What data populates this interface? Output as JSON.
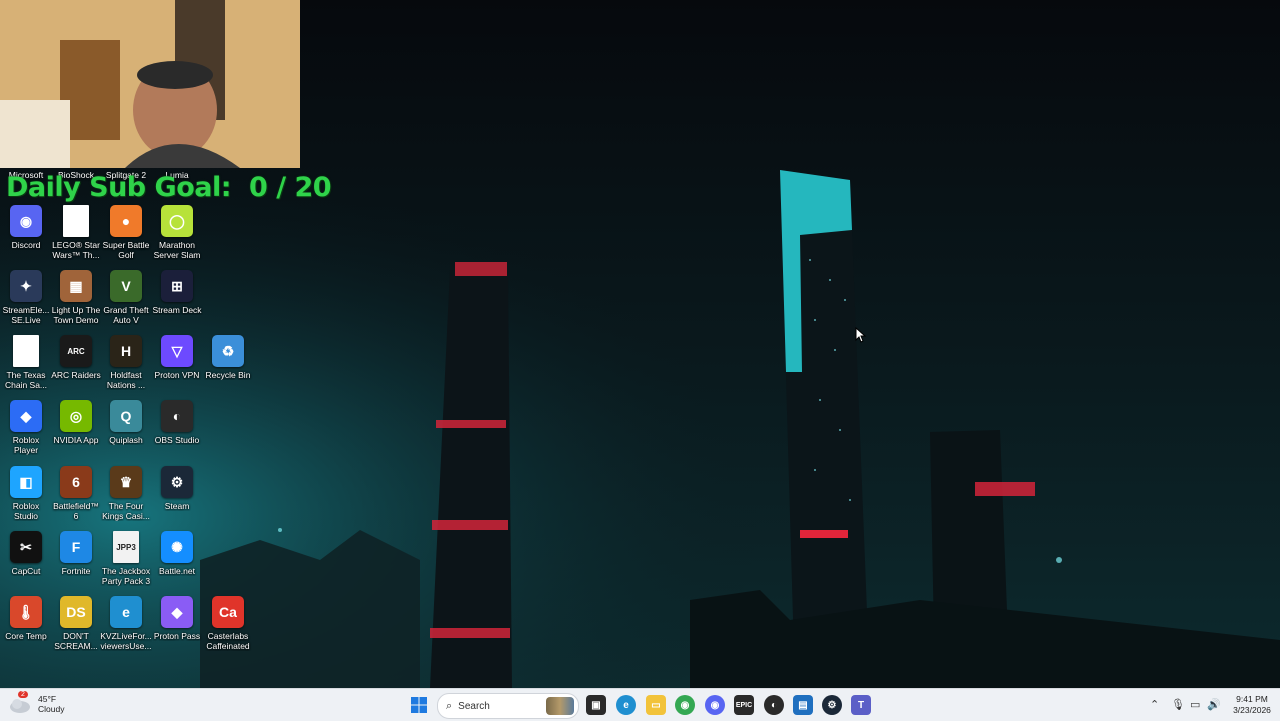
{
  "overlay": {
    "goal_label": "Daily Sub Goal:",
    "goal_value": "0 / 20"
  },
  "desktop": {
    "top_row": [
      "Microsoft",
      "BioShock",
      "Splitgate 2",
      "Lumia"
    ],
    "icons": [
      {
        "label": "Discord",
        "icon": "discord-icon",
        "color": "#5865f2",
        "glyph": "◉"
      },
      {
        "label": "LEGO® Star Wars™ Th...",
        "icon": "file-icon",
        "color": "#ffffff",
        "glyph": ""
      },
      {
        "label": "Super Battle Golf",
        "icon": "golf-icon",
        "color": "#f07a2a",
        "glyph": "●"
      },
      {
        "label": "Marathon Server Slam",
        "icon": "marathon-icon",
        "color": "#b7e23a",
        "glyph": "◯"
      },
      {
        "label": "StreamEle... SE.Live",
        "icon": "streamelements-icon",
        "color": "#2a3a5a",
        "glyph": "✦"
      },
      {
        "label": "Light Up The Town Demo",
        "icon": "game-icon",
        "color": "#a0643a",
        "glyph": "▦"
      },
      {
        "label": "Grand Theft Auto V",
        "icon": "gta-icon",
        "color": "#3a6a2a",
        "glyph": "V"
      },
      {
        "label": "Stream Deck",
        "icon": "stream-deck-icon",
        "color": "#1b1f3a",
        "glyph": "⊞"
      },
      {
        "label": "The Texas Chain Sa...",
        "icon": "file-icon",
        "color": "#ffffff",
        "glyph": ""
      },
      {
        "label": "ARC Raiders",
        "icon": "arc-raiders-icon",
        "color": "#1a1a1a",
        "glyph": "ARC"
      },
      {
        "label": "Holdfast Nations ...",
        "icon": "holdfast-icon",
        "color": "#2a2418",
        "glyph": "H"
      },
      {
        "label": "Proton VPN",
        "icon": "proton-vpn-icon",
        "color": "#6d4aff",
        "glyph": "▽"
      },
      {
        "label": "Recycle Bin",
        "icon": "recycle-bin-icon",
        "color": "#3b8fd9",
        "glyph": "♻"
      },
      {
        "label": "Roblox Player",
        "icon": "roblox-icon",
        "color": "#2c6cf5",
        "glyph": "◆"
      },
      {
        "label": "NVIDIA App",
        "icon": "nvidia-icon",
        "color": "#76b900",
        "glyph": "◎"
      },
      {
        "label": "Quiplash",
        "icon": "quiplash-icon",
        "color": "#3a8a9a",
        "glyph": "Q"
      },
      {
        "label": "OBS Studio",
        "icon": "obs-icon",
        "color": "#2a2a2a",
        "glyph": "◐"
      },
      {
        "label": "Roblox Studio",
        "icon": "roblox-studio-icon",
        "color": "#1ea5ff",
        "glyph": "◧"
      },
      {
        "label": "Battlefield™ 6",
        "icon": "battlefield-icon",
        "color": "#8a3a1a",
        "glyph": "6"
      },
      {
        "label": "The Four Kings Casi...",
        "icon": "four-kings-icon",
        "color": "#5a3a1a",
        "glyph": "♛"
      },
      {
        "label": "Steam",
        "icon": "steam-icon",
        "color": "#1b2838",
        "glyph": "⚙"
      },
      {
        "label": "CapCut",
        "icon": "capcut-icon",
        "color": "#111111",
        "glyph": "✂"
      },
      {
        "label": "Fortnite",
        "icon": "fortnite-icon",
        "color": "#1e88e5",
        "glyph": "F"
      },
      {
        "label": "The Jackbox Party Pack 3",
        "icon": "jackbox-icon",
        "color": "#f2f2f2",
        "glyph": "JPP3"
      },
      {
        "label": "Battle.net",
        "icon": "battlenet-icon",
        "color": "#148eff",
        "glyph": "✺"
      },
      {
        "label": "Core Temp",
        "icon": "core-temp-icon",
        "color": "#d9482b",
        "glyph": "🌡"
      },
      {
        "label": "DON'T SCREAM...",
        "icon": "dont-scream-icon",
        "color": "#e0b82a",
        "glyph": "DS"
      },
      {
        "label": "KVZLiveFor... viewersUse...",
        "icon": "edge-icon",
        "color": "#1f8fd0",
        "glyph": "e"
      },
      {
        "label": "Proton Pass",
        "icon": "proton-pass-icon",
        "color": "#8a5cf5",
        "glyph": "◆"
      },
      {
        "label": "Casterlabs Caffeinated",
        "icon": "casterlabs-icon",
        "color": "#e0342a",
        "glyph": "Ca"
      }
    ]
  },
  "taskbar": {
    "weather_temp": "45°F",
    "weather_desc": "Cloudy",
    "weather_badge": "2",
    "search_placeholder": "Search",
    "apps": [
      "windows-start-icon",
      "search-icon",
      "file-explorer-icon",
      "edge-icon",
      "folder-icon",
      "chrome-icon",
      "discord-icon",
      "epic-games-icon",
      "obs-icon",
      "photos-icon",
      "steam-icon",
      "teams-icon"
    ],
    "time": "9:41 PM",
    "date": "3/23/2026"
  }
}
